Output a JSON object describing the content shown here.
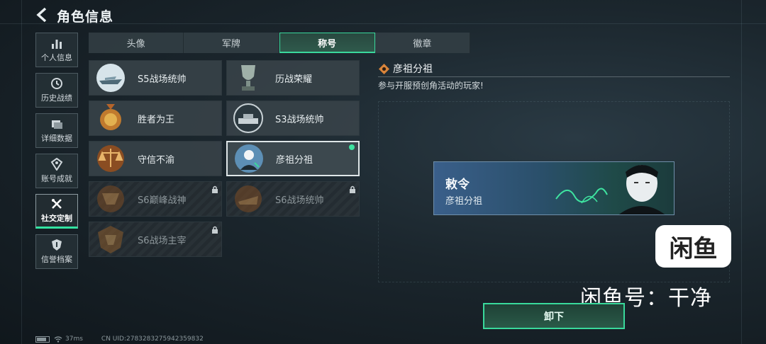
{
  "header": {
    "title": "角色信息"
  },
  "sidebar": {
    "items": [
      {
        "label": "个人信息",
        "icon": "bar-chart-icon",
        "active": false
      },
      {
        "label": "历史战绩",
        "icon": "history-icon",
        "active": false
      },
      {
        "label": "详细数据",
        "icon": "folder-icon",
        "active": false
      },
      {
        "label": "账号成就",
        "icon": "achievement-icon",
        "active": false
      },
      {
        "label": "社交定制",
        "icon": "tools-icon",
        "active": true
      },
      {
        "label": "信誉档案",
        "icon": "credit-shield-icon",
        "active": false
      }
    ]
  },
  "tabs": [
    {
      "label": "头像",
      "active": false
    },
    {
      "label": "军牌",
      "active": false
    },
    {
      "label": "称号",
      "active": true
    },
    {
      "label": "徽章",
      "active": false
    }
  ],
  "titles": [
    {
      "name": "S5战场统帅",
      "emblem": "boat-emblem-icon",
      "locked": false
    },
    {
      "name": "历战荣耀",
      "emblem": "trophy-emblem-icon",
      "locked": false
    },
    {
      "name": "胜者为王",
      "emblem": "medal-emblem-icon",
      "locked": false
    },
    {
      "name": "S3战场统帅",
      "emblem": "tank-emblem-icon",
      "locked": false
    },
    {
      "name": "守信不渝",
      "emblem": "scales-emblem-icon",
      "locked": false
    },
    {
      "name": "彦祖分祖",
      "emblem": "portrait-emblem-icon",
      "locked": false,
      "selected": true
    },
    {
      "name": "S6巅峰战神",
      "emblem": "wings-emblem-icon",
      "locked": true
    },
    {
      "name": "S6战场统帅",
      "emblem": "vehicle-emblem-icon",
      "locked": true
    },
    {
      "name": "S6战场主宰",
      "emblem": "shield-emblem-icon",
      "locked": true
    }
  ],
  "detail": {
    "title": "彦祖分祖",
    "description": "参与开服预创角活动的玩家!",
    "banner": {
      "header": "",
      "top_label": "敕令",
      "name": "彦祖分祖"
    }
  },
  "action": {
    "unequip_label": "卸下"
  },
  "watermark": {
    "logo_text": "闲鱼",
    "text": "闲鱼号：干净"
  },
  "footer": {
    "ping": "37ms",
    "uid": "CN UID:2783283275942359832"
  },
  "colors": {
    "accent": "#3ad99d",
    "selected_dot": "#3ee3a0"
  }
}
